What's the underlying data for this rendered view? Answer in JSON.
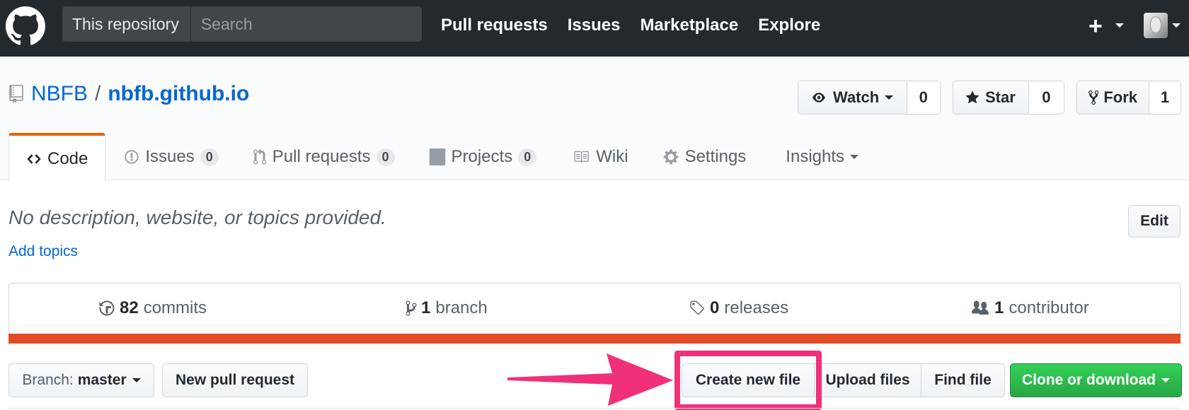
{
  "header": {
    "search_scope": "This repository",
    "search_placeholder": "Search",
    "nav": [
      "Pull requests",
      "Issues",
      "Marketplace",
      "Explore"
    ],
    "plus_label": "+"
  },
  "repo": {
    "owner": "NBFB",
    "separator": "/",
    "name": "nbfb.github.io",
    "watch_label": "Watch",
    "watch_count": "0",
    "star_label": "Star",
    "star_count": "0",
    "fork_label": "Fork",
    "fork_count": "1"
  },
  "tabs": [
    {
      "label": "Code",
      "count": null,
      "icon": "code-icon",
      "selected": true
    },
    {
      "label": "Issues",
      "count": "0",
      "icon": "issue-icon"
    },
    {
      "label": "Pull requests",
      "count": "0",
      "icon": "pull-request-icon"
    },
    {
      "label": "Projects",
      "count": "0",
      "icon": "project-icon"
    },
    {
      "label": "Wiki",
      "count": null,
      "icon": "book-icon"
    },
    {
      "label": "Settings",
      "count": null,
      "icon": "gear-icon"
    },
    {
      "label": "Insights",
      "count": null,
      "icon": null
    }
  ],
  "description": {
    "text": "No description, website, or topics provided.",
    "add_topics": "Add topics",
    "edit_label": "Edit"
  },
  "summary": {
    "commits_count": "82",
    "commits_label": "commits",
    "branch_count": "1",
    "branch_label": "branch",
    "releases_count": "0",
    "releases_label": "releases",
    "contributor_count": "1",
    "contributor_label": "contributor",
    "language_color": "#e34c26"
  },
  "file_nav": {
    "branch_prefix": "Branch:",
    "branch_name": "master",
    "new_pr_label": "New pull request",
    "create_file_label": "Create new file",
    "upload_label": "Upload files",
    "find_label": "Find file",
    "clone_label": "Clone or download"
  },
  "colors": {
    "header_bg": "#24292e",
    "link": "#0366d6",
    "selected_tab_accent": "#e36209",
    "clone_green": "#28a745",
    "annotation_pink": "#f0317a"
  }
}
